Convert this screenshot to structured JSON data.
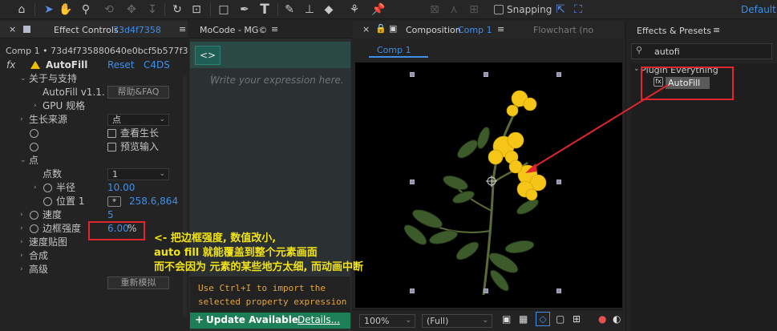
{
  "toolbar": {
    "snapping_label": "Snapping",
    "workspace_label": "Default",
    "icons": [
      "home-icon",
      "selection-tool-icon",
      "hand-tool-icon",
      "zoom-tool-icon",
      "orbit-camera-icon",
      "pan-camera-icon",
      "dolly-camera-icon",
      "rotate-tool-icon",
      "pan-behind-icon",
      "rectangle-tool-icon",
      "pen-tool-icon",
      "type-tool-icon",
      "brush-tool-icon",
      "clone-stamp-icon",
      "eraser-icon",
      "roto-brush-icon",
      "puppet-pin-icon"
    ]
  },
  "effect_controls": {
    "tab_label": "Effect Controls",
    "tab_layer": "73d4f7358",
    "breadcrumb": "Comp 1 • 73d4f735880640e0bcf5b577f3",
    "effect_name": "AutoFill",
    "reset_label": "Reset",
    "vendor_label": "C4DS",
    "about_group": "关于与支持",
    "version": "AutoFill v1.1.",
    "help_button": "帮助&FAQ",
    "gpu_spec": "GPU 规格",
    "growth_source": "生长来源",
    "growth_source_value": "点",
    "view_growth": "查看生长",
    "preview_input": "预览输入",
    "point_group": "点",
    "point_count": "点数",
    "point_count_value": "1",
    "radius": "半径",
    "radius_value": "10.00",
    "position": "位置 1",
    "position_value": "258.6,864",
    "speed": "速度",
    "speed_value": "5",
    "edge_strength": "边框强度",
    "edge_strength_value": "6.00",
    "edge_strength_unit": "%",
    "speed_map": "速度贴图",
    "composite": "合成",
    "advanced": "高级",
    "resimulate_button": "重新模拟"
  },
  "mocode": {
    "tab_label": "MoCode - MG©",
    "code_button": "<>",
    "placeholder": "Write your expression here.",
    "help_line1": "Use Ctrl+I to import the",
    "help_line2": "selected property expression",
    "update_label": "Update Available",
    "details_label": "Details..."
  },
  "composition": {
    "tab_prefix": "Composition",
    "tab_name": "Comp 1",
    "flowchart_tab": "Flowchart (no",
    "sub_tab": "Comp 1",
    "zoom": "100%",
    "resolution": "(Full)"
  },
  "effects_presets": {
    "tab_label": "Effects & Presets",
    "search_value": "autofi",
    "category": "Plugin Everything",
    "item": "AutoFill"
  },
  "annotation": {
    "line1": "<- 把边框强度, 数值改小,",
    "line2": "auto fill 就能覆盖到整个元素画面",
    "line3": "而不会因为 元素的某些地方太细, 而动画中断"
  },
  "colors": {
    "accent_blue": "#3f8fe8",
    "annotation_red": "#e0262c",
    "annotation_yellow": "#f2e313",
    "update_green": "#1d7f58"
  }
}
